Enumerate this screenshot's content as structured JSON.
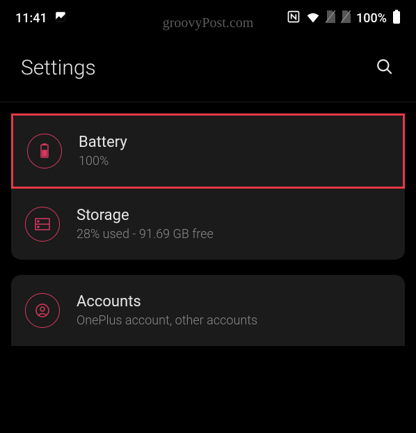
{
  "watermark": "groovyPost.com",
  "status": {
    "time": "11:41",
    "battery_percent": "100%"
  },
  "header": {
    "title": "Settings"
  },
  "items": {
    "battery": {
      "title": "Battery",
      "subtitle": "100%"
    },
    "storage": {
      "title": "Storage",
      "subtitle": "28% used - 91.69 GB free"
    },
    "accounts": {
      "title": "Accounts",
      "subtitle": "OnePlus account, other accounts"
    }
  }
}
